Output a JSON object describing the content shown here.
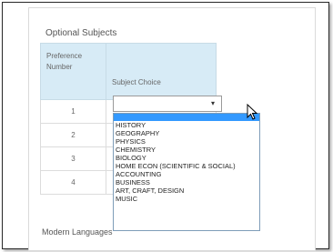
{
  "section_title": "Optional Subjects",
  "table": {
    "header_preference_line1": "Preference",
    "header_preference_line2": "Number",
    "header_choice": "Subject Choice",
    "rows": [
      "1",
      "2",
      "3",
      "4"
    ]
  },
  "select": {
    "selected_value": "",
    "arrow": "▾"
  },
  "dropdown": {
    "options": [
      "",
      "HISTORY",
      "GEOGRAPHY",
      "PHYSICS",
      "CHEMISTRY",
      "BIOLOGY",
      "HOME ECON (SCIENTIFIC & SOCIAL)",
      "ACCOUNTING",
      "BUSINESS",
      "ART, CRAFT, DESIGN",
      "MUSIC"
    ]
  },
  "next_section_partial": "Modern Languages"
}
